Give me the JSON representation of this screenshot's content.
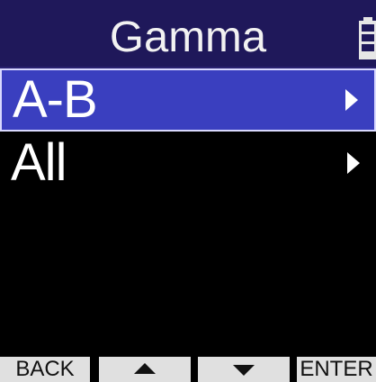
{
  "title": "Gamma",
  "status": {
    "battery_icon": "battery-full-icon"
  },
  "menu": {
    "items": [
      {
        "label": "A-B",
        "selected": true,
        "icon": "chevron-right-icon"
      },
      {
        "label": "All",
        "selected": false,
        "icon": "chevron-right-icon"
      }
    ]
  },
  "function_bar": {
    "back_label": "BACK",
    "up_icon": "triangle-up-icon",
    "down_icon": "triangle-down-icon",
    "enter_label": "ENTER"
  },
  "colors": {
    "title_bg": "#1f185a",
    "selection_bg": "#3a3fbf",
    "background": "#000000",
    "function_bar_bg": "#e0e0e0"
  }
}
